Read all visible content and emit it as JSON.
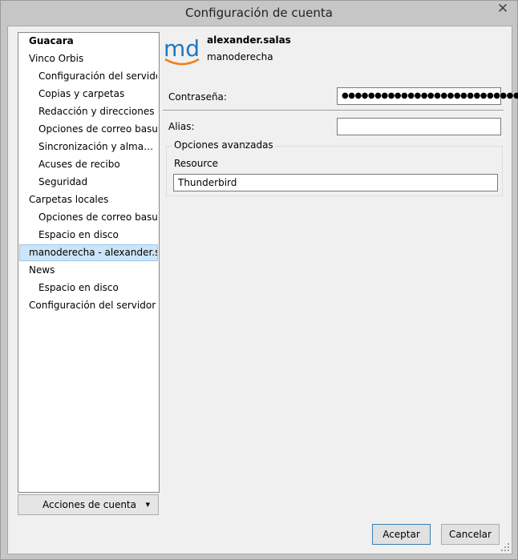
{
  "window": {
    "title": "Configuración de cuenta",
    "close_glyph": "✕"
  },
  "tree": {
    "arrow_collapsed": "▷",
    "arrow_expanded": "◢",
    "items": [
      {
        "label": "Guacara"
      },
      {
        "label": "Vinco Orbis"
      },
      {
        "label": "Configuración del servidor"
      },
      {
        "label": "Copias y carpetas"
      },
      {
        "label": "Redacción y direcciones"
      },
      {
        "label": "Opciones de correo basura"
      },
      {
        "label": "Sincronización y almacenamiento"
      },
      {
        "label": "Acuses de recibo"
      },
      {
        "label": "Seguridad"
      },
      {
        "label": "Carpetas locales"
      },
      {
        "label": "Opciones de correo basura"
      },
      {
        "label": "Espacio en disco"
      },
      {
        "label": "manoderecha - alexander.salas"
      },
      {
        "label": "News"
      },
      {
        "label": "Espacio en disco"
      },
      {
        "label": "Configuración del servidor saliente (SMTP)"
      }
    ]
  },
  "account_actions": {
    "label": "Acciones de cuenta",
    "caret": "▼"
  },
  "account": {
    "logo_text": "md",
    "name": "alexander.salas",
    "server": "manoderecha"
  },
  "form": {
    "password_label": "Contraseña:",
    "password_value": "●●●●●●●●●●●●●●●●●●●●●●●●●●●",
    "alias_label": "Alias:",
    "alias_value": "",
    "advanced_title": "Opciones avanzadas",
    "resource_label": "Resource",
    "resource_value": "Thunderbird"
  },
  "buttons": {
    "accept": "Aceptar",
    "cancel": "Cancelar"
  },
  "colors": {
    "logo_blue": "#1d78c1",
    "logo_orange": "#f07d1a",
    "selection": "#cce4f7"
  }
}
